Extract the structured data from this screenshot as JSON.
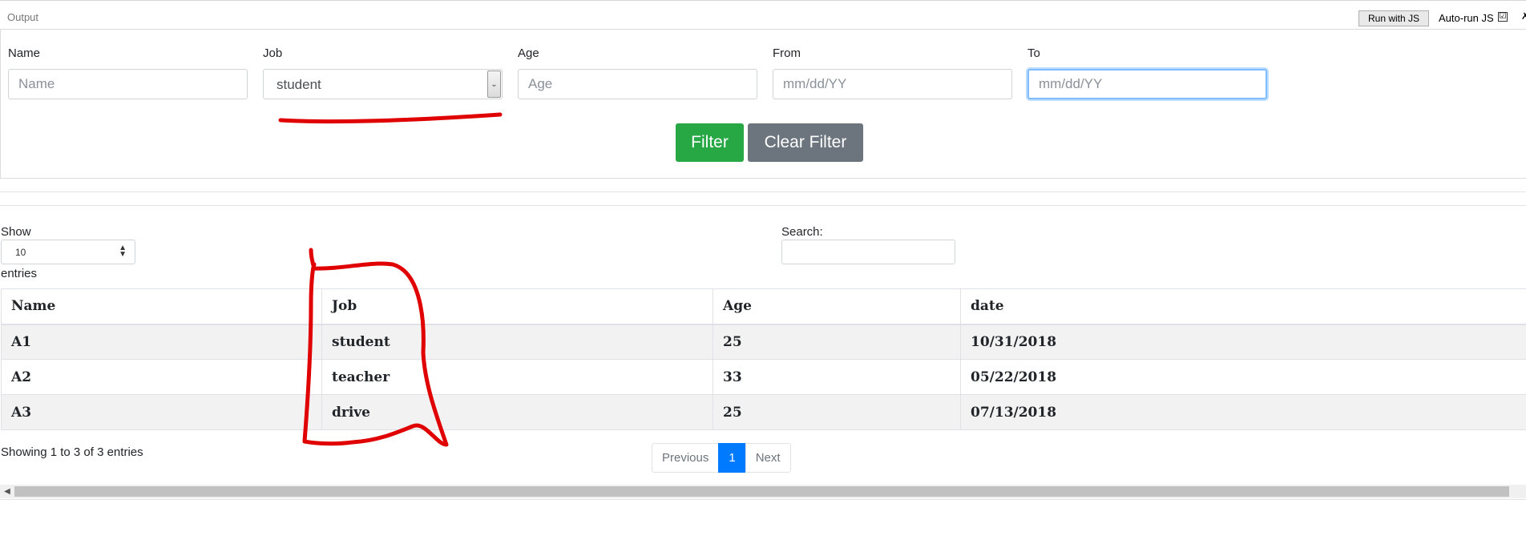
{
  "header": {
    "output_label": "Output",
    "run_button": "Run with JS",
    "autorun_label": "Auto-run JS",
    "autorun_check": "☑",
    "corner_glyph": "✗"
  },
  "filters": {
    "name": {
      "label": "Name",
      "placeholder": "Name",
      "value": ""
    },
    "job": {
      "label": "Job",
      "value": "student"
    },
    "age": {
      "label": "Age",
      "placeholder": "Age",
      "value": ""
    },
    "from": {
      "label": "From",
      "placeholder": "mm/dd/YY",
      "value": ""
    },
    "to": {
      "label": "To",
      "placeholder": "mm/dd/YY",
      "value": ""
    },
    "filter_button": "Filter",
    "clear_button": "Clear Filter"
  },
  "table_controls": {
    "show_label": "Show",
    "page_length": "10",
    "entries_label": "entries",
    "search_label": "Search:",
    "search_value": ""
  },
  "table": {
    "columns": [
      "Name",
      "Job",
      "Age",
      "date"
    ],
    "rows": [
      [
        "A1",
        "student",
        "25",
        "10/31/2018"
      ],
      [
        "A2",
        "teacher",
        "33",
        "05/22/2018"
      ],
      [
        "A3",
        "drive",
        "25",
        "07/13/2018"
      ]
    ]
  },
  "footer": {
    "info": "Showing 1 to 3 of 3 entries",
    "previous": "Previous",
    "current_page": "1",
    "next": "Next"
  },
  "colors": {
    "filter_button": "#28a745",
    "clear_button": "#6c757d",
    "active_page": "#007bff",
    "annotation": "#e00000"
  }
}
